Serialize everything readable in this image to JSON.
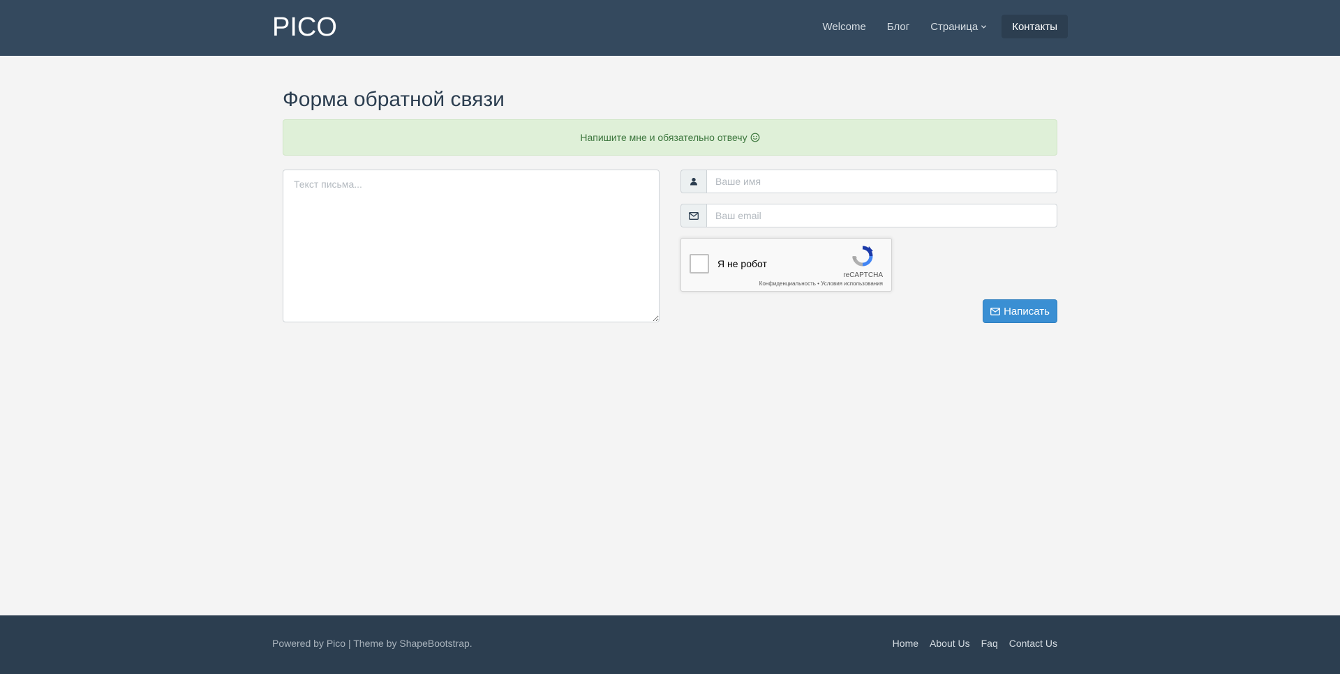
{
  "navbar": {
    "brand": "PICO",
    "items": [
      {
        "label": "Welcome"
      },
      {
        "label": "Блог"
      },
      {
        "label": "Страница"
      },
      {
        "label": "Контакты"
      }
    ]
  },
  "page": {
    "title": "Форма обратной связи",
    "alert": "Напишите мне и обязательно отвечу"
  },
  "form": {
    "message_placeholder": "Текст письма...",
    "name_placeholder": "Ваше имя",
    "email_placeholder": "Ваш email",
    "submit_label": "Написать"
  },
  "recaptcha": {
    "label": "Я не робот",
    "brand": "reCAPTCHA",
    "privacy": "Конфиденциальность",
    "separator": " • ",
    "terms": "Условия использования"
  },
  "footer": {
    "powered_prefix": "Powered by ",
    "powered_link": "Pico",
    "theme_prefix": " | Theme by ",
    "theme_link": "ShapeBootstrap",
    "theme_suffix": ".",
    "links": [
      {
        "label": "Home"
      },
      {
        "label": "About Us"
      },
      {
        "label": "Faq"
      },
      {
        "label": "Contact Us"
      }
    ]
  },
  "colors": {
    "navbar": "#34495e",
    "footer": "#2c3e50",
    "accent": "#3a8fd3",
    "alert_bg": "#dff0d8",
    "alert_text": "#3c763d"
  },
  "icons": {
    "name_addon": "user-icon",
    "email_addon": "envelope-icon",
    "dropdown": "chevron-down-icon",
    "alert": "smile-icon"
  }
}
